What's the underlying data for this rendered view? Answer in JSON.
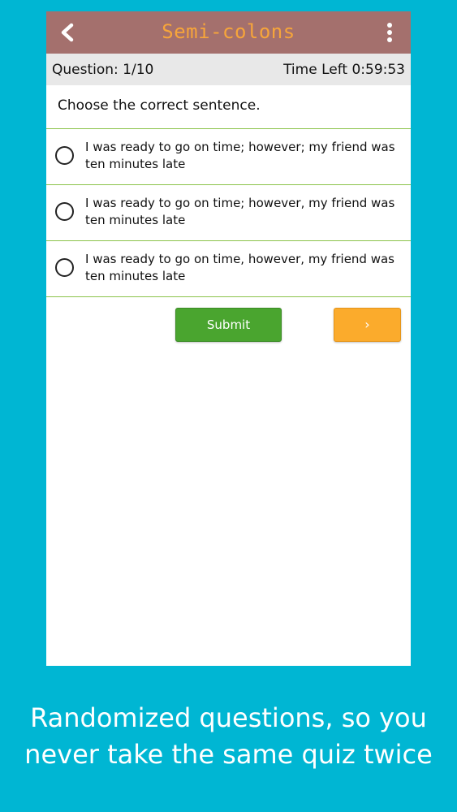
{
  "app": {
    "title": "Semi-colons",
    "accent_color": "#f7a53a",
    "appbar_color": "#a4706d",
    "back_icon": "chevron-left-icon",
    "menu_icon": "more-vertical-icon"
  },
  "quiz": {
    "question_counter": "Question: 1/10",
    "time_left": "Time Left 0:59:53",
    "prompt": "Choose the correct sentence.",
    "options": [
      "I was ready to go on time; however; my friend was ten minutes late",
      "I was ready to go on time; however, my friend was ten minutes late",
      "I was ready to go on time, however, my friend was ten minutes late"
    ],
    "submit_label": "Submit",
    "next_label": "›",
    "submit_color": "#4aa52f",
    "next_color": "#fbab2c",
    "divider_color": "#8bc34a"
  },
  "promo": {
    "line1": "Randomized questions, so you",
    "line2": "never take the same quiz twice",
    "background_color": "#00b6d3"
  }
}
